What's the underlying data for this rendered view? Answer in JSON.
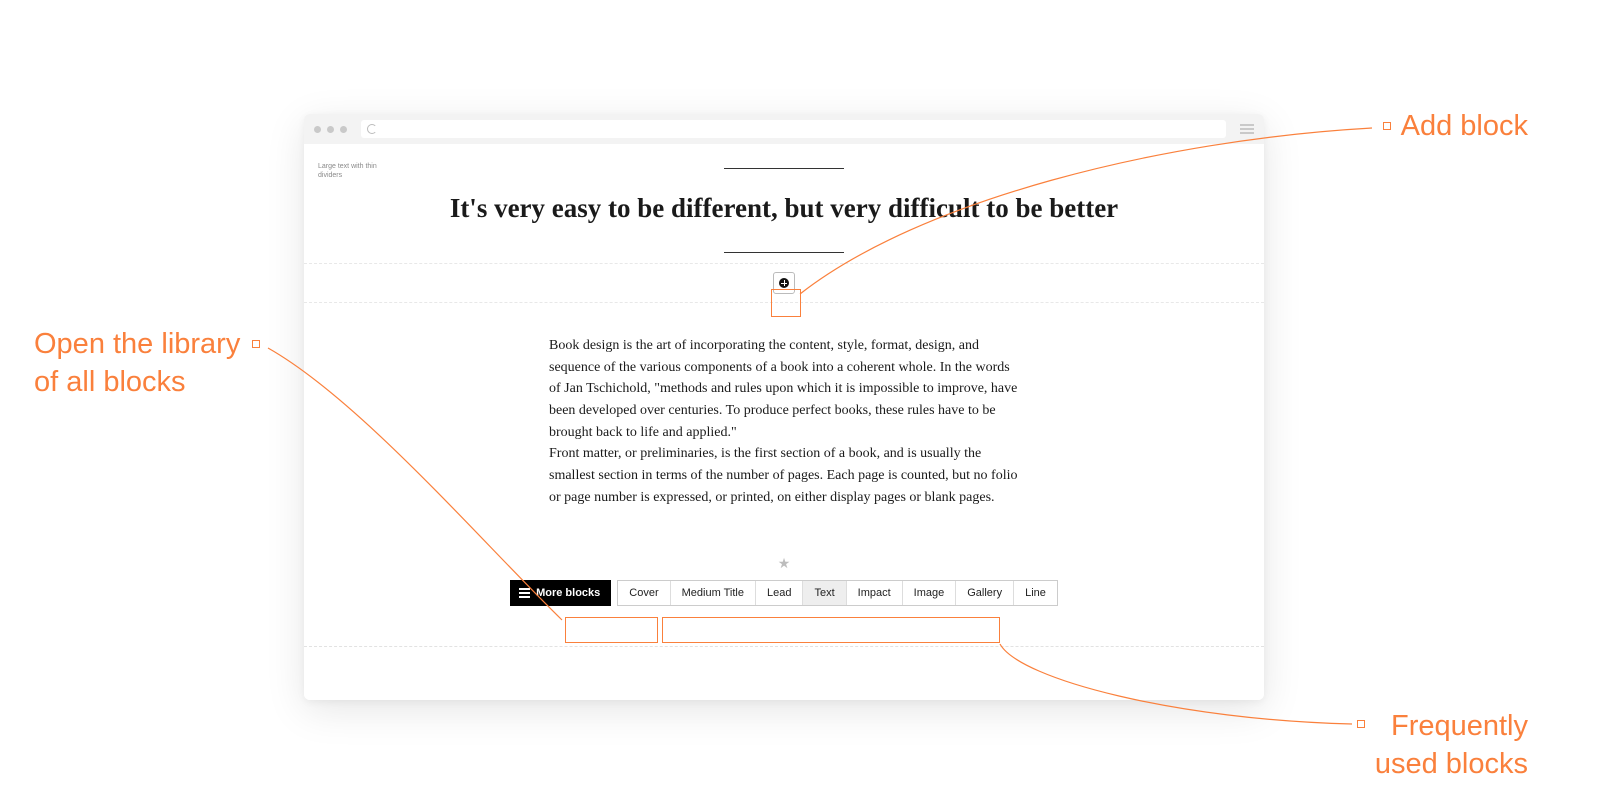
{
  "annotations": {
    "add_block": "Add block",
    "open_library_line1": "Open the library",
    "open_library_line2": "of all blocks",
    "frequently_line1": "Frequently",
    "frequently_line2": "used blocks"
  },
  "editor": {
    "sidebar_note": "Large text with thin dividers",
    "headline": "It's very easy to be different, but very difficult to be better",
    "paragraph1": "Book design is the art of incorporating the content, style, format, design, and sequence of the various components of a book into a coherent whole. In the words of Jan Tschichold, \"methods and rules upon which it is impossible to improve, have been developed over centuries. To produce perfect books, these rules have to be brought back to life and applied.\"",
    "paragraph2": "Front matter, or preliminaries, is the first section of a book, and is usually the smallest section in terms of the number of pages. Each page is counted, but no folio or page number is expressed, or printed, on either display pages or blank pages.",
    "star": "★"
  },
  "toolbar": {
    "more_blocks": "More blocks",
    "quick": [
      "Cover",
      "Medium Title",
      "Lead",
      "Text",
      "Impact",
      "Image",
      "Gallery",
      "Line"
    ],
    "active_index": 3
  },
  "colors": {
    "accent": "#fa803c"
  }
}
